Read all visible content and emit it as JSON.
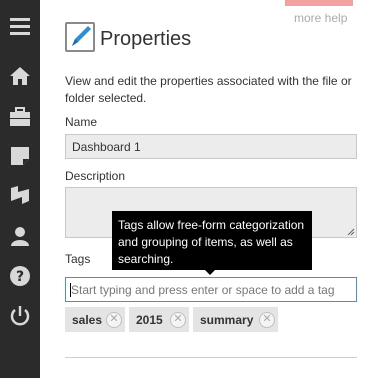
{
  "sidebar": {
    "items": [
      {
        "icon": "menu-icon"
      },
      {
        "icon": "home-icon"
      },
      {
        "icon": "briefcase-icon"
      },
      {
        "icon": "note-icon"
      },
      {
        "icon": "folder-open-icon"
      },
      {
        "icon": "user-icon"
      },
      {
        "icon": "help-icon"
      },
      {
        "icon": "power-icon"
      }
    ]
  },
  "header": {
    "help_link": "more help",
    "title": "Properties",
    "icon": "edit-properties-icon"
  },
  "main": {
    "description": "View and edit the properties associated with the file or folder selected.",
    "name_label": "Name",
    "name_value": "Dashboard 1",
    "description_label": "Description",
    "description_value": "",
    "tags_label": "Tags",
    "tags_placeholder": "Start typing and press enter or space to add a tag",
    "tooltip": "Tags allow free-form categorization and grouping of items, as well as searching.",
    "tags": [
      {
        "label": "sales"
      },
      {
        "label": "2015"
      },
      {
        "label": "summary"
      }
    ]
  },
  "colors": {
    "sidebar_bg": "#2b2b2b",
    "accent_border": "#4a90c8",
    "help_button": "#f2a0a0",
    "tooltip_bg": "#000000"
  }
}
